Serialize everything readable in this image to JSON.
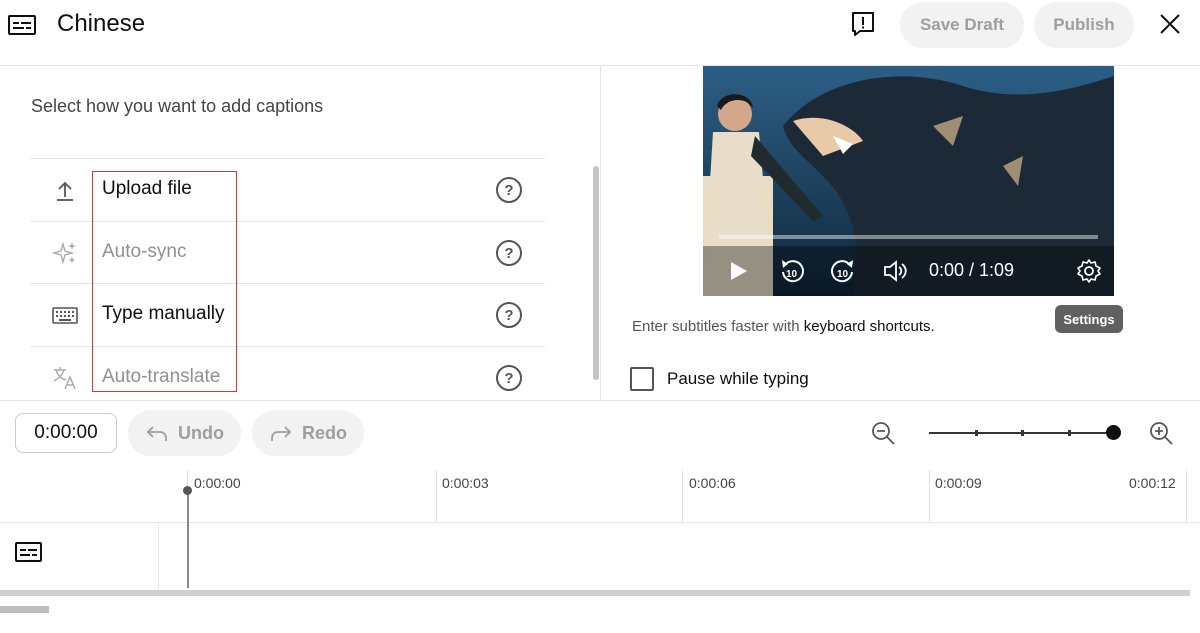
{
  "header": {
    "title": "Chinese",
    "save_draft_label": "Save Draft",
    "publish_label": "Publish"
  },
  "left_panel": {
    "prompt": "Select how you want to add captions",
    "options": [
      {
        "label": "Upload file",
        "icon": "upload-icon",
        "enabled": true
      },
      {
        "label": "Auto-sync",
        "icon": "sparkle-icon",
        "enabled": false
      },
      {
        "label": "Type manually",
        "icon": "keyboard-icon",
        "enabled": true
      },
      {
        "label": "Auto-translate",
        "icon": "translate-icon",
        "enabled": false
      }
    ],
    "help_symbol": "?"
  },
  "video": {
    "time": "0:00 / 1:09",
    "rewind_seconds": "10",
    "forward_seconds": "10",
    "settings_tooltip": "Settings"
  },
  "shortcuts": {
    "text": "Enter subtitles faster with ",
    "link": "keyboard shortcuts."
  },
  "pause_while_typing": {
    "label": "Pause while typing",
    "checked": false
  },
  "timeline": {
    "timecode": "0:00:00",
    "undo_label": "Undo",
    "redo_label": "Redo",
    "ruler_labels": [
      "0:00:00",
      "0:00:03",
      "0:00:06",
      "0:00:09",
      "0:00:12"
    ],
    "zoom_level": 1.0
  },
  "colors": {
    "highlight_box": "#dd3333",
    "disabled_text": "#909090",
    "pill_bg": "#f2f2f2"
  }
}
